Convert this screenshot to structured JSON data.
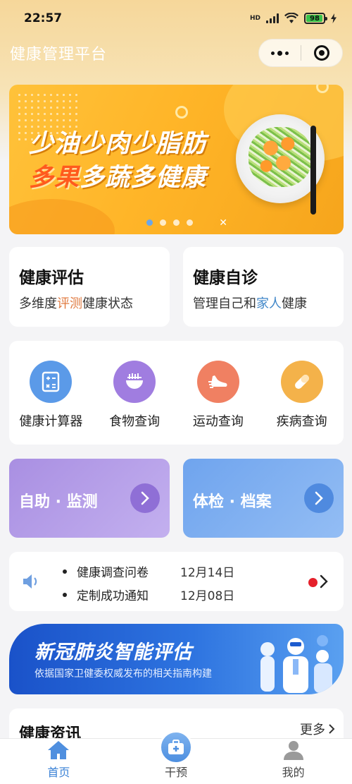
{
  "status": {
    "time": "22:57",
    "network": "HD",
    "battery": "98",
    "battery_level": 0.98
  },
  "nav": {
    "title": "健康管理平台"
  },
  "banner": {
    "line1": "少油少肉少脂肪",
    "line2_accent": "多果",
    "line2_rest": "多蔬多健康",
    "slides": 4,
    "active_slide": 1
  },
  "entries": [
    {
      "title": "健康评估",
      "sub_pre": "多维度",
      "sub_hl": "评测",
      "sub_post": "健康状态"
    },
    {
      "title": "健康自诊",
      "sub_pre": "管理自己和",
      "sub_hl": "家人",
      "sub_post": "健康"
    }
  ],
  "tools": [
    {
      "label": "健康计算器",
      "icon": "calculator-icon",
      "color": "#5b9ae8"
    },
    {
      "label": "食物查询",
      "icon": "food-bowl-icon",
      "color": "#a07de0"
    },
    {
      "label": "运动查询",
      "icon": "running-shoe-icon",
      "color": "#f08062"
    },
    {
      "label": "疾病查询",
      "icon": "pill-icon",
      "color": "#f4b24a"
    }
  ],
  "actions": [
    {
      "label": "自助 · 监测",
      "color_from": "#a98fe2",
      "color_to": "#c3b0ef"
    },
    {
      "label": "体检 · 档案",
      "color_from": "#6fa4ee",
      "color_to": "#93bdf4"
    }
  ],
  "notices": [
    {
      "title": "健康调查问卷",
      "date": "12月14日"
    },
    {
      "title": "定制成功通知",
      "date": "12月08日"
    }
  ],
  "covid": {
    "title": "新冠肺炎智能评估",
    "subtitle": "依据国家卫健委权威发布的相关指南构建"
  },
  "news": {
    "title": "健康资讯",
    "more": "更多"
  },
  "tabs": [
    {
      "label": "首页",
      "icon": "home-icon",
      "active": true
    },
    {
      "label": "干预",
      "icon": "medical-kit-icon",
      "active": false
    },
    {
      "label": "我的",
      "icon": "user-icon",
      "active": false
    }
  ]
}
